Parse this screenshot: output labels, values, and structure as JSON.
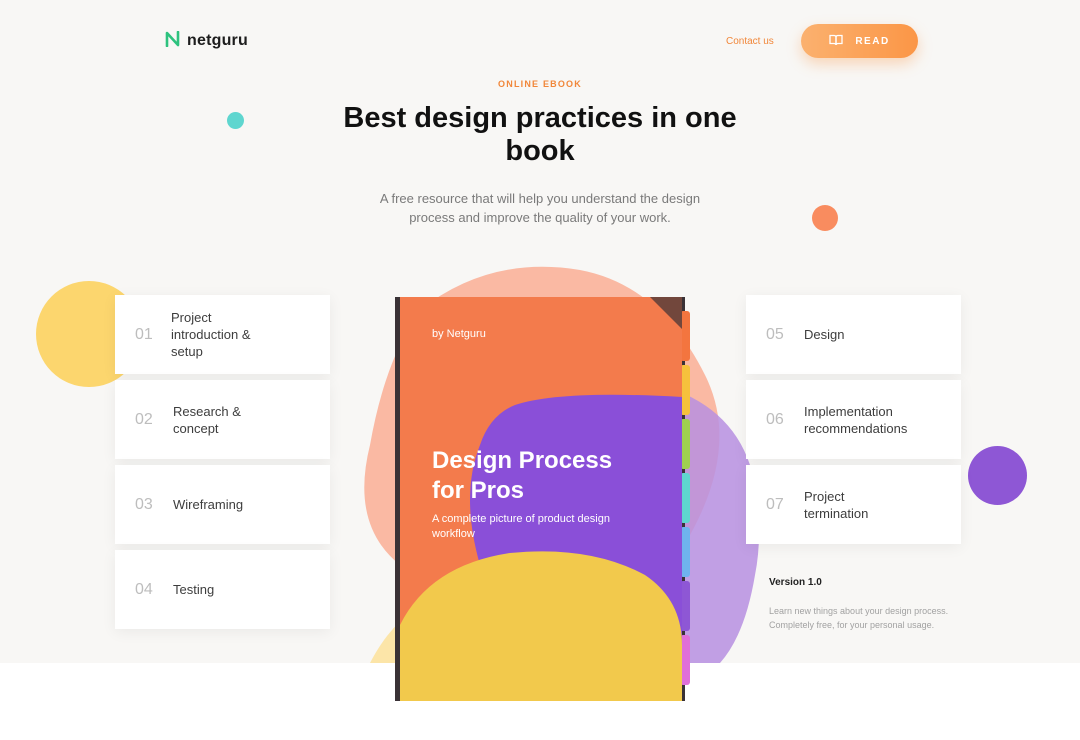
{
  "header": {
    "logo_text": "netguru",
    "contact_label": "Contact us",
    "read_label": "READ"
  },
  "hero": {
    "eyebrow": "ONLINE EBOOK",
    "title": "Best design practices in one book",
    "subtitle": "A free resource that will help you understand the design process and improve the quality of your work."
  },
  "chapters_left": [
    {
      "num": "01",
      "label": "Project introduction & setup"
    },
    {
      "num": "02",
      "label": "Research & concept"
    },
    {
      "num": "03",
      "label": "Wireframing"
    },
    {
      "num": "04",
      "label": "Testing"
    }
  ],
  "chapters_right": [
    {
      "num": "05",
      "label": "Design"
    },
    {
      "num": "06",
      "label": "Implementation recommendations"
    },
    {
      "num": "07",
      "label": "Project termination"
    }
  ],
  "book": {
    "by": "by Netguru",
    "title": "Design Process for Pros",
    "subtitle": "A complete picture of product design workflow"
  },
  "version": {
    "label": "Version 1.0",
    "description": "Learn new things about your design process. Completely free, for your personal usage."
  },
  "colors": {
    "accent_orange": "#f1873a",
    "teal": "#5fd6cf",
    "yellow": "#fcd66e",
    "purple": "#8e57d5",
    "coral": "#f98c5f",
    "logo_green": "#2ec27e"
  },
  "icons": {
    "logo": "netguru-n-icon",
    "read": "open-book-icon"
  }
}
